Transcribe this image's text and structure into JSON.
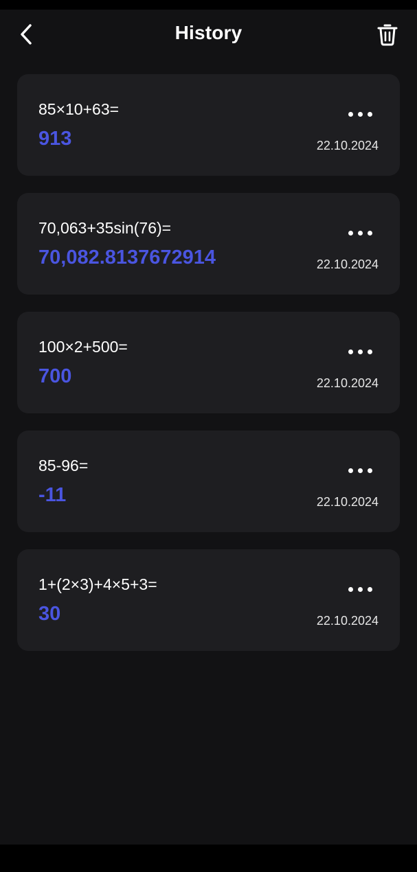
{
  "header": {
    "title": "History",
    "back_icon": "chevron-left-icon",
    "trash_icon": "trash-icon"
  },
  "colors": {
    "background": "#121214",
    "card": "#1e1e21",
    "accent": "#4a55e0",
    "text": "#ffffff"
  },
  "history": [
    {
      "expression": "85×10+63=",
      "result": "913",
      "date": "22.10.2024"
    },
    {
      "expression": "70,063+35sin(76)=",
      "result": "70,082.8137672914",
      "date": "22.10.2024"
    },
    {
      "expression": "100×2+500=",
      "result": "700",
      "date": "22.10.2024"
    },
    {
      "expression": "85-96=",
      "result": "-11",
      "date": "22.10.2024"
    },
    {
      "expression": "1+(2×3)+4×5+3=",
      "result": "30",
      "date": "22.10.2024"
    }
  ],
  "card_more_icon": "more-horizontal-icon"
}
